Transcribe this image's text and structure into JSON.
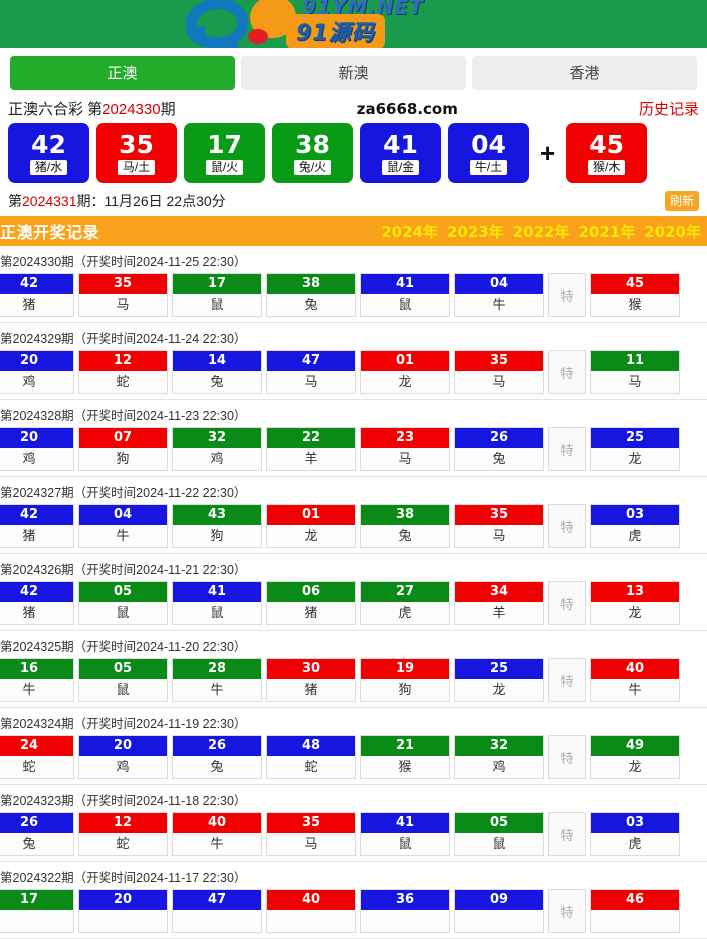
{
  "logo": {
    "net_text": "91YM.NET",
    "plate_text": "91源码",
    "banner_color": "#1a9b4c"
  },
  "tabs": [
    {
      "label": "正澳",
      "active": true
    },
    {
      "label": "新澳",
      "active": false
    },
    {
      "label": "香港",
      "active": false
    }
  ],
  "title": {
    "name": "正澳六合彩 第",
    "issue": "2024330",
    "suffix": "期",
    "site": "za6668.com",
    "history_link": "历史记录"
  },
  "current_draw": {
    "balls": [
      {
        "num": "42",
        "tag": "猪/水",
        "color": "blue"
      },
      {
        "num": "35",
        "tag": "马/土",
        "color": "red"
      },
      {
        "num": "17",
        "tag": "鼠/火",
        "color": "green"
      },
      {
        "num": "38",
        "tag": "兔/火",
        "color": "green"
      },
      {
        "num": "41",
        "tag": "鼠/金",
        "color": "blue"
      },
      {
        "num": "04",
        "tag": "牛/土",
        "color": "blue"
      }
    ],
    "plus": "+",
    "special": {
      "num": "45",
      "tag": "猴/木",
      "color": "red"
    }
  },
  "next_draw": {
    "prefix": "第",
    "issue": "2024331",
    "text": "期：11月26日 22点30分",
    "refresh_label": "刷新"
  },
  "history_bar": {
    "title": "正澳开奖记录",
    "years": [
      "2024年",
      "2023年",
      "2022年",
      "2021年",
      "2020年"
    ]
  },
  "special_col_label": "特",
  "results": [
    {
      "head": "第2024330期（开奖时间2024-11-25 22:30）",
      "cells": [
        {
          "num": "42",
          "zod": "猪",
          "color": "blue"
        },
        {
          "num": "35",
          "zod": "马",
          "color": "red"
        },
        {
          "num": "17",
          "zod": "鼠",
          "color": "green"
        },
        {
          "num": "38",
          "zod": "兔",
          "color": "green"
        },
        {
          "num": "41",
          "zod": "鼠",
          "color": "blue"
        },
        {
          "num": "04",
          "zod": "牛",
          "color": "blue"
        }
      ],
      "special": {
        "num": "45",
        "zod": "猴",
        "color": "red"
      }
    },
    {
      "head": "第2024329期（开奖时间2024-11-24 22:30）",
      "cells": [
        {
          "num": "20",
          "zod": "鸡",
          "color": "blue"
        },
        {
          "num": "12",
          "zod": "蛇",
          "color": "red"
        },
        {
          "num": "14",
          "zod": "兔",
          "color": "blue"
        },
        {
          "num": "47",
          "zod": "马",
          "color": "blue"
        },
        {
          "num": "01",
          "zod": "龙",
          "color": "red"
        },
        {
          "num": "35",
          "zod": "马",
          "color": "red"
        }
      ],
      "special": {
        "num": "11",
        "zod": "马",
        "color": "green"
      }
    },
    {
      "head": "第2024328期（开奖时间2024-11-23 22:30）",
      "cells": [
        {
          "num": "20",
          "zod": "鸡",
          "color": "blue"
        },
        {
          "num": "07",
          "zod": "狗",
          "color": "red"
        },
        {
          "num": "32",
          "zod": "鸡",
          "color": "green"
        },
        {
          "num": "22",
          "zod": "羊",
          "color": "green"
        },
        {
          "num": "23",
          "zod": "马",
          "color": "red"
        },
        {
          "num": "26",
          "zod": "兔",
          "color": "blue"
        }
      ],
      "special": {
        "num": "25",
        "zod": "龙",
        "color": "blue"
      }
    },
    {
      "head": "第2024327期（开奖时间2024-11-22 22:30）",
      "cells": [
        {
          "num": "42",
          "zod": "猪",
          "color": "blue"
        },
        {
          "num": "04",
          "zod": "牛",
          "color": "blue"
        },
        {
          "num": "43",
          "zod": "狗",
          "color": "green"
        },
        {
          "num": "01",
          "zod": "龙",
          "color": "red"
        },
        {
          "num": "38",
          "zod": "兔",
          "color": "green"
        },
        {
          "num": "35",
          "zod": "马",
          "color": "red"
        }
      ],
      "special": {
        "num": "03",
        "zod": "虎",
        "color": "blue"
      }
    },
    {
      "head": "第2024326期（开奖时间2024-11-21 22:30）",
      "cells": [
        {
          "num": "42",
          "zod": "猪",
          "color": "blue"
        },
        {
          "num": "05",
          "zod": "鼠",
          "color": "green"
        },
        {
          "num": "41",
          "zod": "鼠",
          "color": "blue"
        },
        {
          "num": "06",
          "zod": "猪",
          "color": "green"
        },
        {
          "num": "27",
          "zod": "虎",
          "color": "green"
        },
        {
          "num": "34",
          "zod": "羊",
          "color": "red"
        }
      ],
      "special": {
        "num": "13",
        "zod": "龙",
        "color": "red"
      }
    },
    {
      "head": "第2024325期（开奖时间2024-11-20 22:30）",
      "cells": [
        {
          "num": "16",
          "zod": "牛",
          "color": "green"
        },
        {
          "num": "05",
          "zod": "鼠",
          "color": "green"
        },
        {
          "num": "28",
          "zod": "牛",
          "color": "green"
        },
        {
          "num": "30",
          "zod": "猪",
          "color": "red"
        },
        {
          "num": "19",
          "zod": "狗",
          "color": "red"
        },
        {
          "num": "25",
          "zod": "龙",
          "color": "blue"
        }
      ],
      "special": {
        "num": "40",
        "zod": "牛",
        "color": "red"
      }
    },
    {
      "head": "第2024324期（开奖时间2024-11-19 22:30）",
      "cells": [
        {
          "num": "24",
          "zod": "蛇",
          "color": "red"
        },
        {
          "num": "20",
          "zod": "鸡",
          "color": "blue"
        },
        {
          "num": "26",
          "zod": "兔",
          "color": "blue"
        },
        {
          "num": "48",
          "zod": "蛇",
          "color": "blue"
        },
        {
          "num": "21",
          "zod": "猴",
          "color": "green"
        },
        {
          "num": "32",
          "zod": "鸡",
          "color": "green"
        }
      ],
      "special": {
        "num": "49",
        "zod": "龙",
        "color": "green"
      }
    },
    {
      "head": "第2024323期（开奖时间2024-11-18 22:30）",
      "cells": [
        {
          "num": "26",
          "zod": "兔",
          "color": "blue"
        },
        {
          "num": "12",
          "zod": "蛇",
          "color": "red"
        },
        {
          "num": "40",
          "zod": "牛",
          "color": "red"
        },
        {
          "num": "35",
          "zod": "马",
          "color": "red"
        },
        {
          "num": "41",
          "zod": "鼠",
          "color": "blue"
        },
        {
          "num": "05",
          "zod": "鼠",
          "color": "green"
        }
      ],
      "special": {
        "num": "03",
        "zod": "虎",
        "color": "blue"
      }
    },
    {
      "head": "第2024322期（开奖时间2024-11-17 22:30）",
      "cells": [
        {
          "num": "17",
          "zod": "",
          "color": "green"
        },
        {
          "num": "20",
          "zod": "",
          "color": "blue"
        },
        {
          "num": "47",
          "zod": "",
          "color": "blue"
        },
        {
          "num": "40",
          "zod": "",
          "color": "red"
        },
        {
          "num": "36",
          "zod": "",
          "color": "blue"
        },
        {
          "num": "09",
          "zod": "",
          "color": "blue"
        }
      ],
      "special": {
        "num": "46",
        "zod": "",
        "color": "red"
      }
    }
  ]
}
